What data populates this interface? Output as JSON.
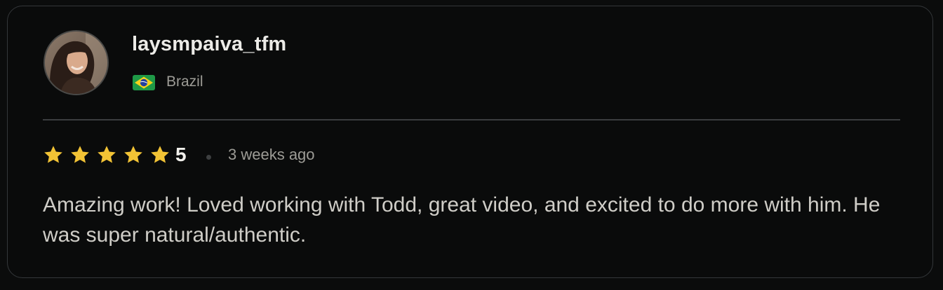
{
  "review": {
    "username": "laysmpaiva_tfm",
    "country": "Brazil",
    "flag_icon": "brazil-flag-icon",
    "avatar_icon": "user-avatar-photo",
    "rating": "5",
    "stars": 5,
    "star_color": "#f2c335",
    "time_ago": "3 weeks ago",
    "text": "Amazing work! Loved working with Todd, great video, and excited to do more with him. He was super natural/authentic."
  }
}
